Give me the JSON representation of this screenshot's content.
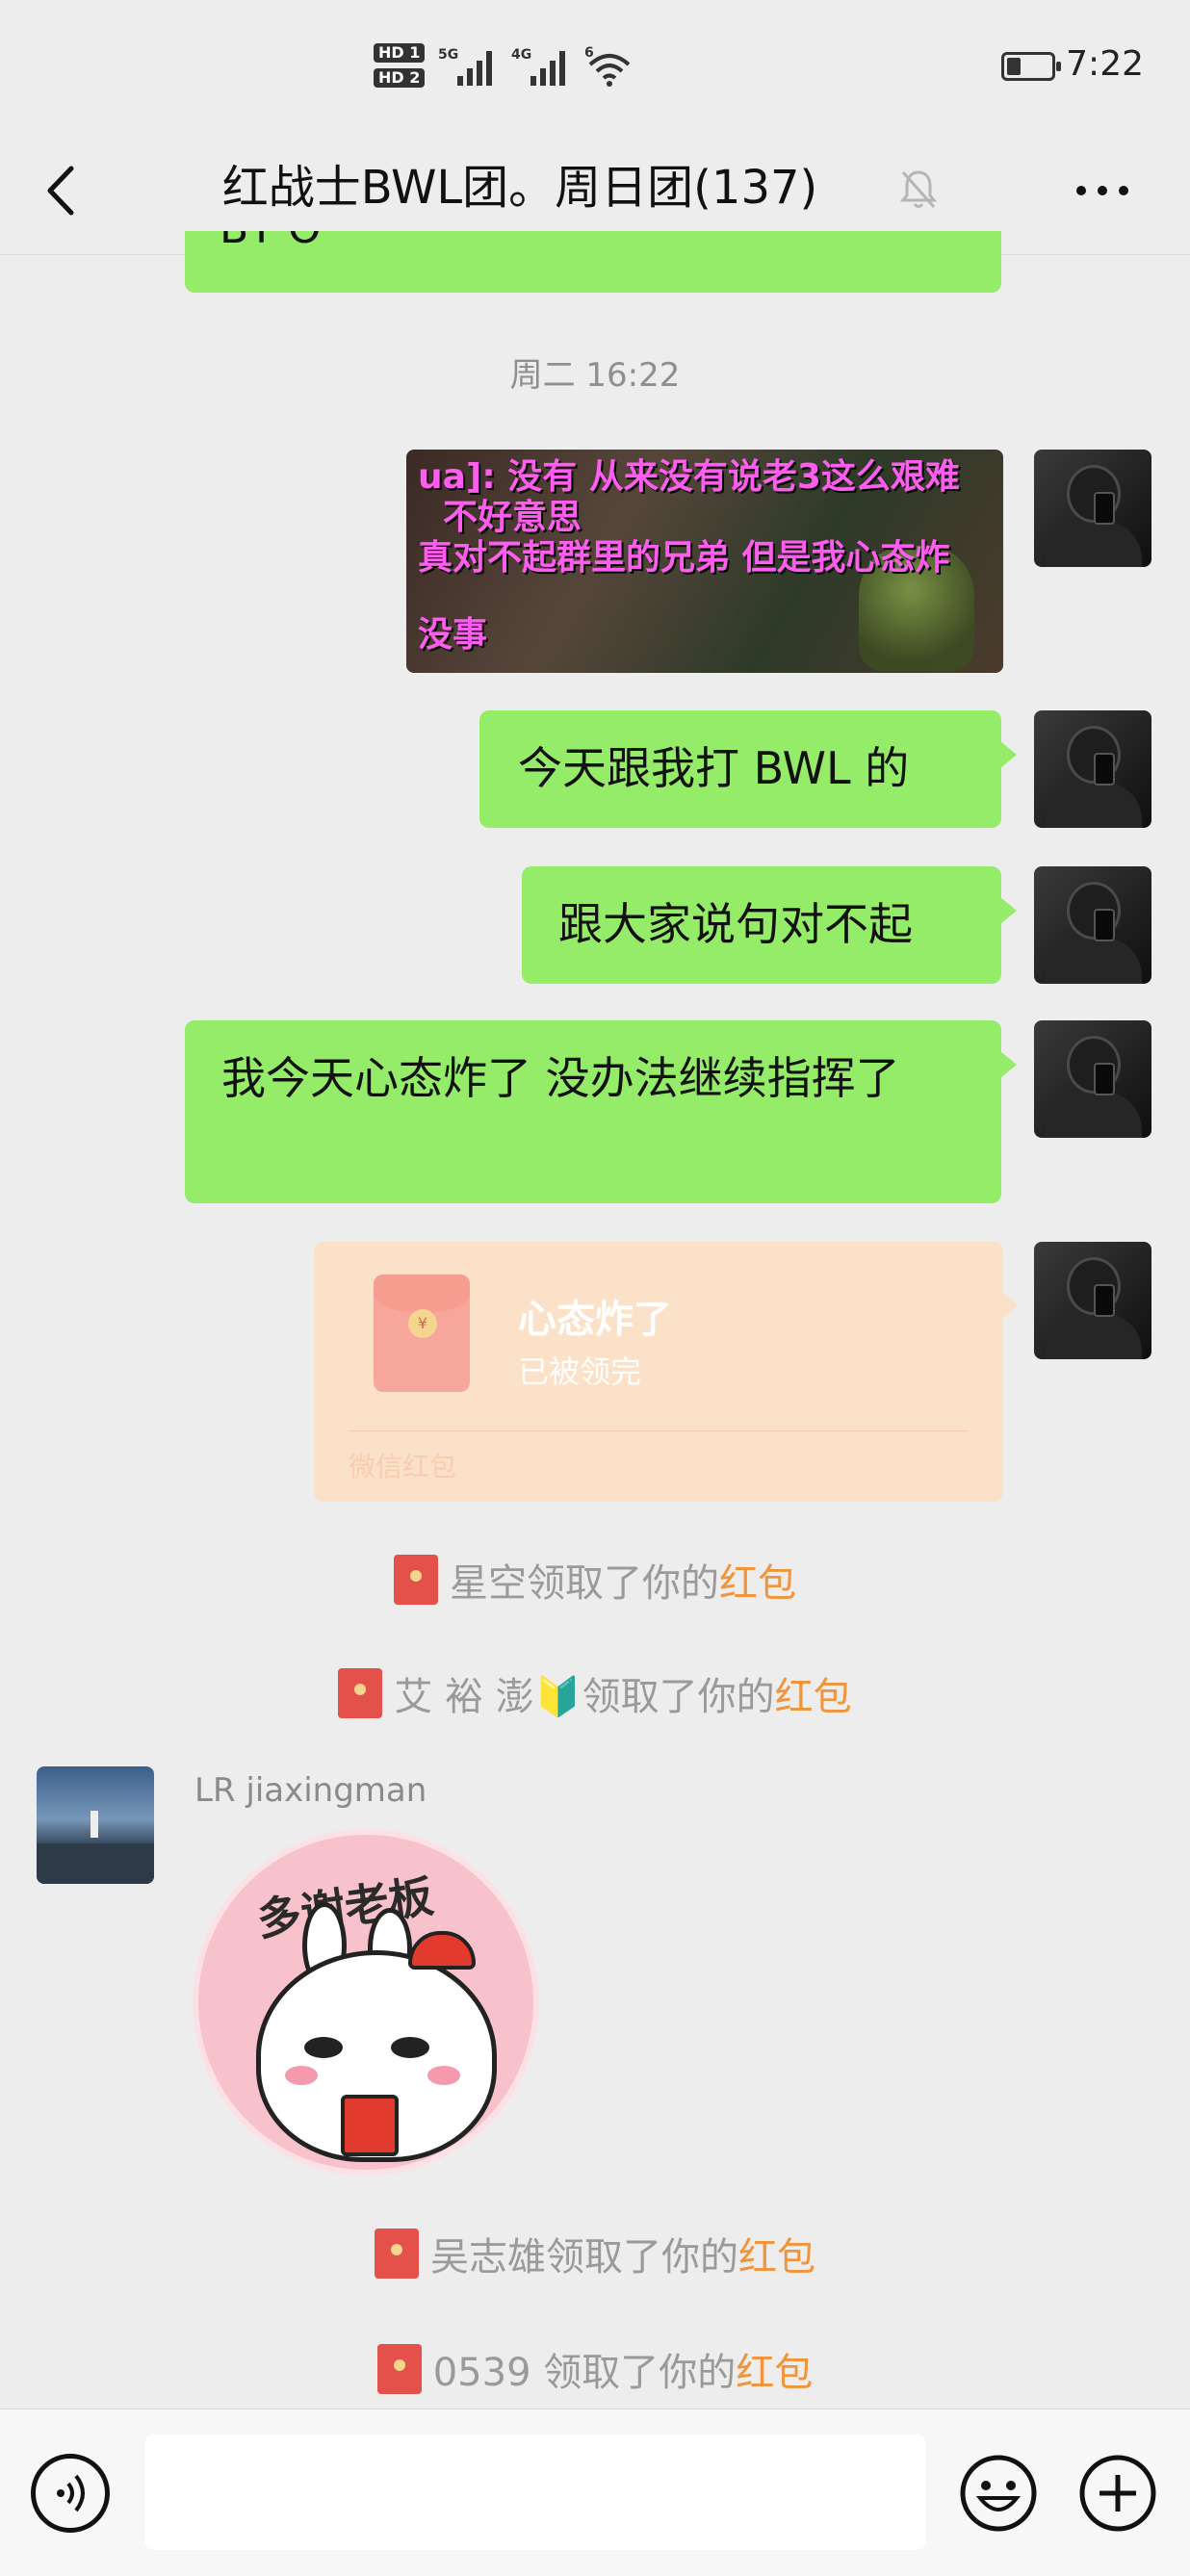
{
  "status_bar": {
    "hd1": "HD 1",
    "hd2": "HD 2",
    "net1": "5G",
    "net2": "4G",
    "wifi": "6",
    "clock": "7:22"
  },
  "header": {
    "title": "红战士BWL团。周日团(137)",
    "back_icon": "chevron-left-icon",
    "mute_icon": "bell-off-icon",
    "more_icon": "more-dots-icon"
  },
  "messages": {
    "partial_top_text": "BT O",
    "time_label": "周二 16:22",
    "image_lines": [
      "ua]: 没有 从来没有说老3这么艰难",
      "不好意思",
      "真对不起群里的兄弟 但是我心态炸",
      "没事"
    ],
    "msg1": "今天跟我打 BWL 的",
    "msg2": "跟大家说句对不起",
    "msg3": "我今天心态炸了 没办法继续指挥了",
    "red_packet": {
      "title": "心态炸了",
      "status": "已被领完",
      "footer": "微信红包",
      "coin": "¥"
    }
  },
  "notices": [
    {
      "who": "星空领取了你的",
      "link": "红包"
    },
    {
      "who": "艾 裕 澎🔰领取了你的",
      "link": "红包"
    },
    {
      "who": "吴志雄领取了你的",
      "link": "红包"
    },
    {
      "who": "0539 领取了你的",
      "link": "红包"
    }
  ],
  "other_user": {
    "name": "LR jiaxingman",
    "sticker_text": "多谢老板"
  },
  "input_bar": {
    "voice_icon": "voice-icon",
    "emoji_icon": "emoji-icon",
    "plus_icon": "plus-icon",
    "text_value": ""
  },
  "colors": {
    "bubble_green": "#95ec69",
    "red_packet_bg": "#fbe1c7",
    "link_orange": "#f1943b",
    "background": "#ededed"
  }
}
